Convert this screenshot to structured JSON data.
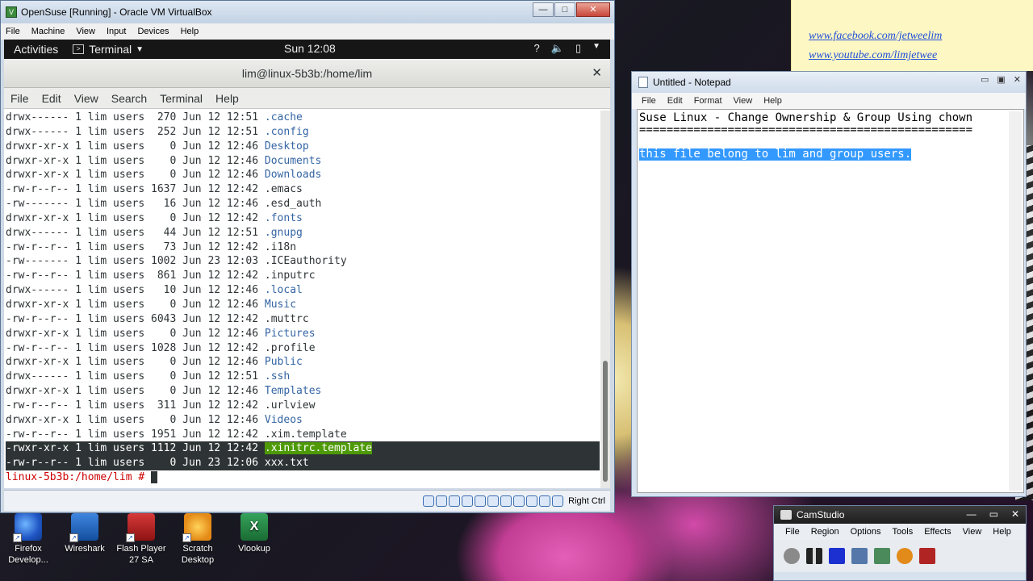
{
  "vbox": {
    "title": "OpenSuse [Running] - Oracle VM VirtualBox",
    "menu": [
      "File",
      "Machine",
      "View",
      "Input",
      "Devices",
      "Help"
    ],
    "status_label": "Right Ctrl"
  },
  "gnome": {
    "activities": "Activities",
    "app": "Terminal",
    "clock": "Sun 12:08"
  },
  "terminal": {
    "title": "lim@linux-5b3b:/home/lim",
    "menu": [
      "File",
      "Edit",
      "View",
      "Search",
      "Terminal",
      "Help"
    ],
    "listing": [
      {
        "perm": "drwx------",
        "n": "1",
        "user": "lim",
        "group": "users",
        "size": "270",
        "date": "Jun 12 12:51",
        "name": ".cache",
        "dir": true
      },
      {
        "perm": "drwx------",
        "n": "1",
        "user": "lim",
        "group": "users",
        "size": "252",
        "date": "Jun 12 12:51",
        "name": ".config",
        "dir": true
      },
      {
        "perm": "drwxr-xr-x",
        "n": "1",
        "user": "lim",
        "group": "users",
        "size": "0",
        "date": "Jun 12 12:46",
        "name": "Desktop",
        "dir": true
      },
      {
        "perm": "drwxr-xr-x",
        "n": "1",
        "user": "lim",
        "group": "users",
        "size": "0",
        "date": "Jun 12 12:46",
        "name": "Documents",
        "dir": true
      },
      {
        "perm": "drwxr-xr-x",
        "n": "1",
        "user": "lim",
        "group": "users",
        "size": "0",
        "date": "Jun 12 12:46",
        "name": "Downloads",
        "dir": true
      },
      {
        "perm": "-rw-r--r--",
        "n": "1",
        "user": "lim",
        "group": "users",
        "size": "1637",
        "date": "Jun 12 12:42",
        "name": ".emacs",
        "dir": false
      },
      {
        "perm": "-rw-------",
        "n": "1",
        "user": "lim",
        "group": "users",
        "size": "16",
        "date": "Jun 12 12:46",
        "name": ".esd_auth",
        "dir": false
      },
      {
        "perm": "drwxr-xr-x",
        "n": "1",
        "user": "lim",
        "group": "users",
        "size": "0",
        "date": "Jun 12 12:42",
        "name": ".fonts",
        "dir": true
      },
      {
        "perm": "drwx------",
        "n": "1",
        "user": "lim",
        "group": "users",
        "size": "44",
        "date": "Jun 12 12:51",
        "name": ".gnupg",
        "dir": true
      },
      {
        "perm": "-rw-r--r--",
        "n": "1",
        "user": "lim",
        "group": "users",
        "size": "73",
        "date": "Jun 12 12:42",
        "name": ".i18n",
        "dir": false
      },
      {
        "perm": "-rw-------",
        "n": "1",
        "user": "lim",
        "group": "users",
        "size": "1002",
        "date": "Jun 23 12:03",
        "name": ".ICEauthority",
        "dir": false
      },
      {
        "perm": "-rw-r--r--",
        "n": "1",
        "user": "lim",
        "group": "users",
        "size": "861",
        "date": "Jun 12 12:42",
        "name": ".inputrc",
        "dir": false
      },
      {
        "perm": "drwx------",
        "n": "1",
        "user": "lim",
        "group": "users",
        "size": "10",
        "date": "Jun 12 12:46",
        "name": ".local",
        "dir": true
      },
      {
        "perm": "drwxr-xr-x",
        "n": "1",
        "user": "lim",
        "group": "users",
        "size": "0",
        "date": "Jun 12 12:46",
        "name": "Music",
        "dir": true
      },
      {
        "perm": "-rw-r--r--",
        "n": "1",
        "user": "lim",
        "group": "users",
        "size": "6043",
        "date": "Jun 12 12:42",
        "name": ".muttrc",
        "dir": false
      },
      {
        "perm": "drwxr-xr-x",
        "n": "1",
        "user": "lim",
        "group": "users",
        "size": "0",
        "date": "Jun 12 12:46",
        "name": "Pictures",
        "dir": true
      },
      {
        "perm": "-rw-r--r--",
        "n": "1",
        "user": "lim",
        "group": "users",
        "size": "1028",
        "date": "Jun 12 12:42",
        "name": ".profile",
        "dir": false
      },
      {
        "perm": "drwxr-xr-x",
        "n": "1",
        "user": "lim",
        "group": "users",
        "size": "0",
        "date": "Jun 12 12:46",
        "name": "Public",
        "dir": true
      },
      {
        "perm": "drwx------",
        "n": "1",
        "user": "lim",
        "group": "users",
        "size": "0",
        "date": "Jun 12 12:51",
        "name": ".ssh",
        "dir": true
      },
      {
        "perm": "drwxr-xr-x",
        "n": "1",
        "user": "lim",
        "group": "users",
        "size": "0",
        "date": "Jun 12 12:46",
        "name": "Templates",
        "dir": true
      },
      {
        "perm": "-rw-r--r--",
        "n": "1",
        "user": "lim",
        "group": "users",
        "size": "311",
        "date": "Jun 12 12:42",
        "name": ".urlview",
        "dir": false
      },
      {
        "perm": "drwxr-xr-x",
        "n": "1",
        "user": "lim",
        "group": "users",
        "size": "0",
        "date": "Jun 12 12:46",
        "name": "Videos",
        "dir": true
      },
      {
        "perm": "-rw-r--r--",
        "n": "1",
        "user": "lim",
        "group": "users",
        "size": "1951",
        "date": "Jun 12 12:42",
        "name": ".xim.template",
        "dir": false
      },
      {
        "perm": "-rwxr-xr-x",
        "n": "1",
        "user": "lim",
        "group": "users",
        "size": "1112",
        "date": "Jun 12 12:42",
        "name": ".xinitrc.template",
        "dir": false,
        "selected": true,
        "exec": true
      },
      {
        "perm": "-rw-r--r--",
        "n": "1",
        "user": "lim",
        "group": "users",
        "size": "0",
        "date": "Jun 23 12:06",
        "name": "xxx.txt",
        "dir": false,
        "selected": true
      }
    ],
    "prompt": "linux-5b3b:/home/lim #"
  },
  "links": {
    "facebook": "www.facebook.com/jetweelim",
    "youtube": "www.youtube.com/limjetwee"
  },
  "notepad": {
    "title": "Untitled - Notepad",
    "menu": [
      "File",
      "Edit",
      "Format",
      "View",
      "Help"
    ],
    "line1": "Suse Linux - Change Ownership & Group Using chown",
    "line2": "=================================================",
    "line3": "",
    "line4": "this file belong to lim and group users."
  },
  "camstudio": {
    "title": "CamStudio",
    "menu": [
      "File",
      "Region",
      "Options",
      "Tools",
      "Effects",
      "View",
      "Help"
    ]
  },
  "desktop_icons": [
    {
      "label": "Firefox Develop...",
      "color": "#2a6fd1"
    },
    {
      "label": "Wireshark",
      "color": "#1d5fb0"
    },
    {
      "label": "Flash Player 27 SA",
      "color": "#b31b1b"
    },
    {
      "label": "Scratch Desktop",
      "color": "#e8a22a"
    },
    {
      "label": "Vlookup",
      "color": "#1f7a3a"
    }
  ]
}
